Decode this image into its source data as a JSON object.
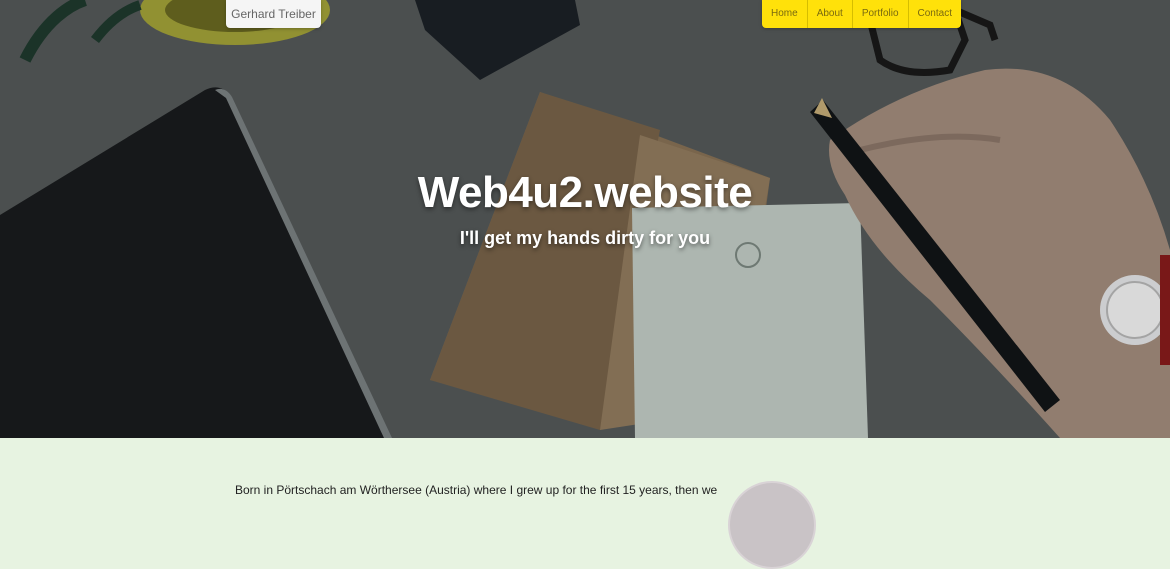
{
  "header": {
    "brand": "Gerhard Treiber",
    "nav": [
      "Home",
      "About",
      "Portfolio",
      "Contact"
    ]
  },
  "hero": {
    "title": "Web4u2.website",
    "subtitle": "I'll get my hands dirty for you"
  },
  "about": {
    "text": "Born in Pörtschach am Wörthersee (Austria) where I grew up for the first 15 years, then we"
  },
  "colors": {
    "nav_background": "#ffe10a",
    "section_background": "#e7f3e1"
  }
}
